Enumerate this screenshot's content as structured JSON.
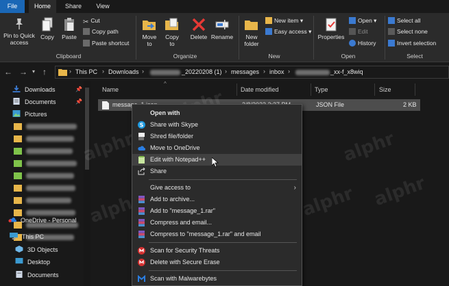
{
  "tabs": [
    "File",
    "Home",
    "Share",
    "View"
  ],
  "ribbon": {
    "clipboard": {
      "label": "Clipboard",
      "pin": "Pin to Quick access",
      "copy": "Copy",
      "paste": "Paste",
      "cut": "Cut",
      "copy_path": "Copy path",
      "paste_shortcut": "Paste shortcut"
    },
    "organize": {
      "label": "Organize",
      "move_to": "Move to",
      "copy_to": "Copy to",
      "delete": "Delete",
      "rename": "Rename"
    },
    "new": {
      "label": "New",
      "new_folder": "New folder",
      "new_item": "New item",
      "easy_access": "Easy access"
    },
    "open": {
      "label": "Open",
      "properties": "Properties",
      "open": "Open",
      "edit": "Edit",
      "history": "History"
    },
    "select": {
      "label": "Select",
      "select_all": "Select all",
      "select_none": "Select none",
      "invert_selection": "Invert selection"
    }
  },
  "address": {
    "crumbs": [
      "This PC",
      "Downloads",
      "_20220208 (1)",
      "messages",
      "inbox",
      "_xx-f_x8wiq"
    ]
  },
  "nav": {
    "quick_access": [
      {
        "label": "Downloads",
        "icon": "download-icon"
      },
      {
        "label": "Documents",
        "icon": "documents-icon"
      },
      {
        "label": "Pictures",
        "icon": "pictures-icon"
      }
    ],
    "onedrive": "OneDrive - Personal",
    "this_pc": "This PC",
    "pc_items": [
      "3D Objects",
      "Desktop",
      "Documents"
    ]
  },
  "files": {
    "columns": [
      "Name",
      "Date modified",
      "Type",
      "Size"
    ],
    "rows": [
      {
        "name": "message_1.json",
        "date": "2/8/2022 2:37 PM",
        "type": "JSON File",
        "size": "2 KB"
      }
    ]
  },
  "context_menu": {
    "items": [
      {
        "label": "Open with",
        "icon": "",
        "bold": true
      },
      {
        "label": "Share with Skype",
        "icon": "skype-icon"
      },
      {
        "label": "Shred file/folder",
        "icon": "shred-icon"
      },
      {
        "label": "Move to OneDrive",
        "icon": "onedrive-icon"
      },
      {
        "label": "Edit with Notepad++",
        "icon": "notepadpp-icon",
        "hover": true
      },
      {
        "label": "Share",
        "icon": "share-icon"
      },
      {
        "label": "Give access to",
        "icon": "",
        "submenu": true
      },
      {
        "label": "Add to archive...",
        "icon": "winrar-icon"
      },
      {
        "label": "Add to \"message_1.rar\"",
        "icon": "winrar-icon"
      },
      {
        "label": "Compress and email...",
        "icon": "winrar-icon"
      },
      {
        "label": "Compress to \"message_1.rar\" and email",
        "icon": "winrar-icon"
      },
      {
        "label": "Scan for Security Threats",
        "icon": "mcafee-icon"
      },
      {
        "label": "Delete with Secure Erase",
        "icon": "mcafee-icon"
      },
      {
        "label": "Scan with Malwarebytes",
        "icon": "malwarebytes-icon"
      }
    ]
  },
  "watermark": "alphr",
  "colors": {
    "accent": "#1a67b6",
    "bg": "#191919",
    "ribbon": "#2b2b2b",
    "selected_row": "#4d4d4d",
    "menu_hover": "#414141"
  }
}
